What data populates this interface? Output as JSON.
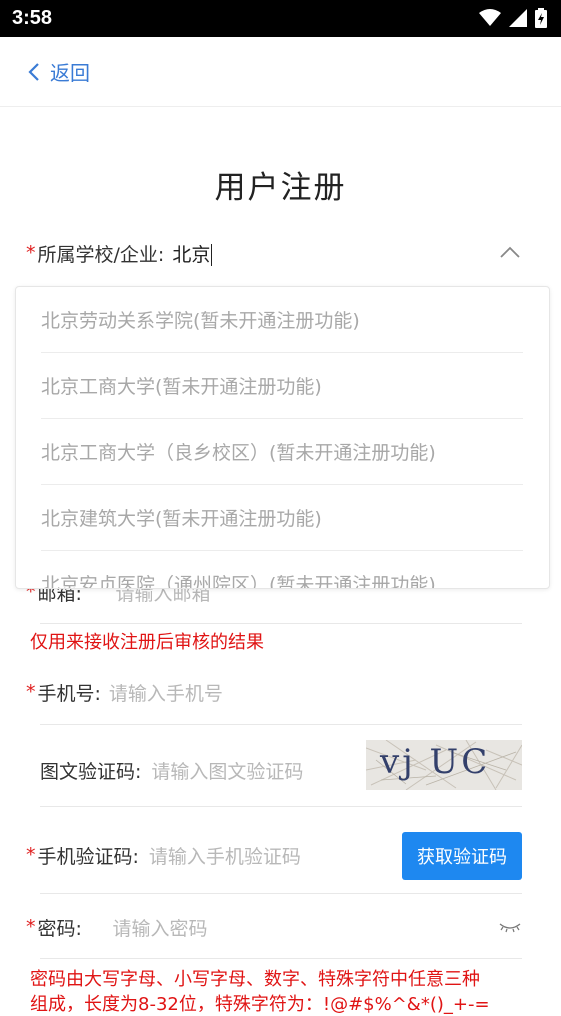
{
  "status_bar": {
    "time": "3:58"
  },
  "nav": {
    "back_label": "返回"
  },
  "title": "用户注册",
  "school": {
    "label": "所属学校/企业:",
    "value": "北京"
  },
  "dropdown": {
    "items": [
      "北京劳动关系学院(暂未开通注册功能)",
      "北京工商大学(暂未开通注册功能)",
      "北京工商大学（良乡校区）(暂未开通注册功能)",
      "北京建筑大学(暂未开通注册功能)",
      "北京安贞医院（通州院区）(暂未开通注册功能)"
    ]
  },
  "email": {
    "label": "邮箱:",
    "placeholder": "请输入邮箱",
    "note": "仅用来接收注册后审核的结果"
  },
  "phone": {
    "label": "手机号:",
    "placeholder": "请输入手机号"
  },
  "image_code": {
    "label": "图文验证码:",
    "placeholder": "请输入图文验证码",
    "captcha_text": "vj UC"
  },
  "sms_code": {
    "label": "手机验证码:",
    "placeholder": "请输入手机验证码",
    "button": "获取验证码"
  },
  "password": {
    "label": "密码:",
    "placeholder": "请输入密码",
    "note_line1": "密码由大写字母、小写字母、数字、特殊字符中任意三种",
    "note_line2": "组成，长度为8-32位，特殊字符为：!@#$%^&*()_+-="
  },
  "colors": {
    "accent": "#1e88f0",
    "link": "#3a7bd5",
    "required": "#e02020"
  }
}
